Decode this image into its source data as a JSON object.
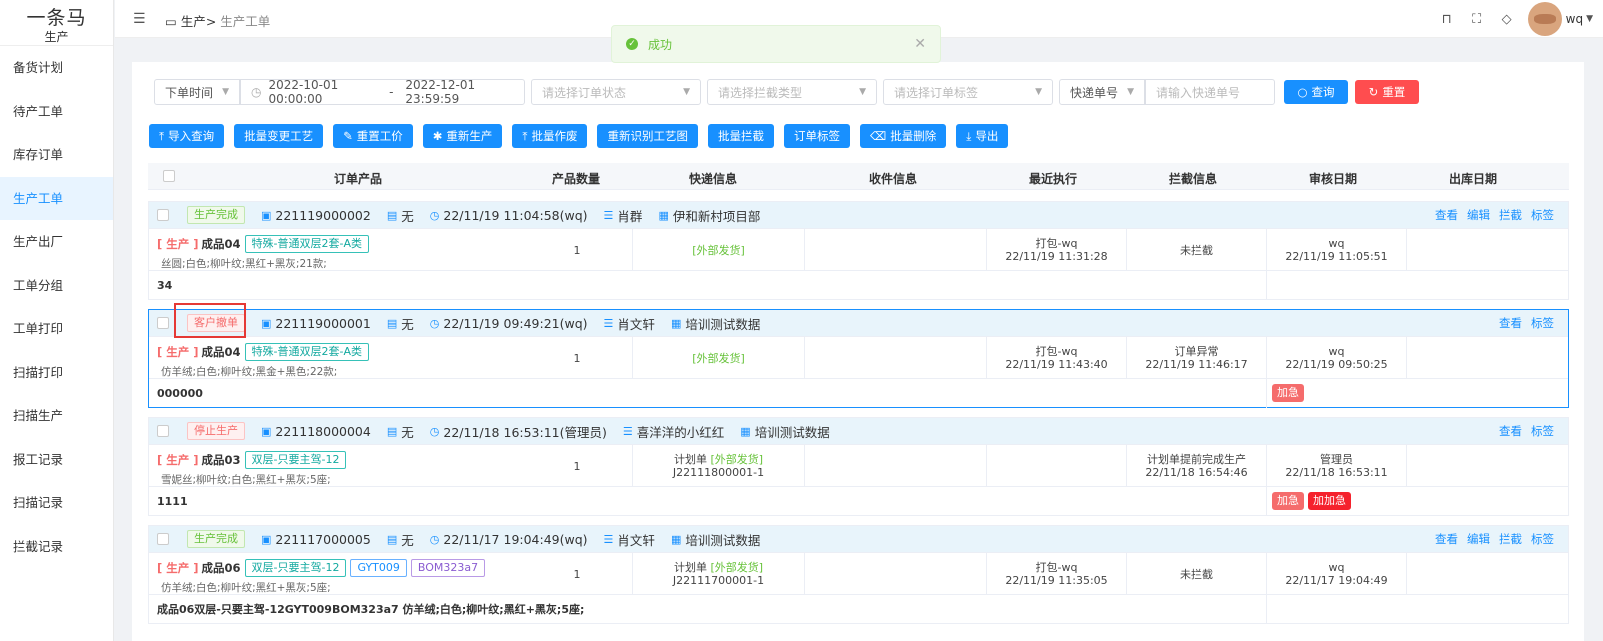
{
  "sidebar": {
    "brand": "一条马",
    "sub": "生产",
    "items": [
      {
        "label": "备货计划"
      },
      {
        "label": "待产工单"
      },
      {
        "label": "库存订单"
      },
      {
        "label": "生产工单",
        "active": true
      },
      {
        "label": "生产出厂"
      },
      {
        "label": "工单分组"
      },
      {
        "label": "工单打印"
      },
      {
        "label": "扫描打印"
      },
      {
        "label": "扫描生产"
      },
      {
        "label": "报工记录"
      },
      {
        "label": "扫描记录"
      },
      {
        "label": "拦截记录"
      }
    ]
  },
  "topbar": {
    "crumb_root": "生产",
    "crumb_sep": ">",
    "crumb_current": "生产工单",
    "user": "wq"
  },
  "toast": {
    "text": "成功"
  },
  "filters": {
    "time_type": "下单时间",
    "start": "2022-10-01 00:00:00",
    "dash": "-",
    "end": "2022-12-01 23:59:59",
    "status_ph": "请选择订单状态",
    "intercept_ph": "请选择拦截类型",
    "tag_ph": "请选择订单标签",
    "express_type": "快递单号",
    "express_ph": "请输入快递单号",
    "query": "查询",
    "reset": "重置"
  },
  "actions": [
    "导入查询",
    "批量变更工艺",
    "重置工价",
    "重新生产",
    "批量作废",
    "重新识别工艺图",
    "批量拦截",
    "订单标签",
    "批量删除",
    "导出"
  ],
  "columns": [
    "订单产品",
    "产品数量",
    "快递信息",
    "收件信息",
    "最近执行",
    "拦截信息",
    "审核日期",
    "出库日期"
  ],
  "orders": [
    {
      "status": "生产完成",
      "no": "221119000002",
      "flag": "无",
      "time": "22/11/19 11:04:58(wq)",
      "customer": "肖群",
      "project": "伊和新村项目部",
      "links": [
        "查看",
        "编辑",
        "拦截",
        "标签"
      ],
      "prod_state": "[ 生产 ]",
      "prod_name": "成品04",
      "tags": [
        "特殊-普通双层2套-A类"
      ],
      "spec": "丝圆;白色;柳叶纹;黑红+黑灰;21款;",
      "qty": "1",
      "express1": "[外部发货]",
      "express2": "",
      "recent1": "打包-wq",
      "recent2": "22/11/19 11:31:28",
      "intercept1": "未拦截",
      "intercept2": "",
      "audit1": "wq",
      "audit2": "22/11/19 11:05:51",
      "remark": "34",
      "urgent": []
    },
    {
      "status": "客户撤单",
      "no": "221119000001",
      "flag": "无",
      "time": "22/11/19 09:49:21(wq)",
      "customer": "肖文轩",
      "project": "培训测试数据",
      "links": [
        "查看",
        "标签"
      ],
      "prod_state": "[ 生产 ]",
      "prod_name": "成品04",
      "tags": [
        "特殊-普通双层2套-A类"
      ],
      "spec": "仿羊绒;白色;柳叶纹;黑金+黑色;22款;",
      "qty": "1",
      "express1": "[外部发货]",
      "express2": "",
      "recent1": "打包-wq",
      "recent2": "22/11/19 11:43:40",
      "intercept1": "订单异常",
      "intercept2": "22/11/19 11:46:17",
      "audit1": "wq",
      "audit2": "22/11/19 09:50:25",
      "remark": "000000",
      "urgent": [
        "加急"
      ]
    },
    {
      "status": "停止生产",
      "no": "221118000004",
      "flag": "无",
      "time": "22/11/18 16:53:11(管理员)",
      "customer": "喜洋洋的小红红",
      "project": "培训测试数据",
      "links": [
        "查看",
        "标签"
      ],
      "prod_state": "[ 生产 ]",
      "prod_name": "成品03",
      "tags": [
        "双层-只要主驾-12"
      ],
      "spec": "雪妮丝;柳叶纹;白色;黑红+黑灰;5座;",
      "qty": "1",
      "express_prefix": "计划单",
      "express1": "[外部发货]",
      "express2": "J22111800001-1",
      "recent1": "",
      "recent2": "",
      "intercept1": "计划单提前完成生产",
      "intercept2": "22/11/18 16:54:46",
      "audit1": "管理员",
      "audit2": "22/11/18 16:53:11",
      "remark": "1111",
      "urgent": [
        "加急",
        "加加急"
      ]
    },
    {
      "status": "生产完成",
      "no": "221117000005",
      "flag": "无",
      "time": "22/11/17 19:04:49(wq)",
      "customer": "肖文轩",
      "project": "培训测试数据",
      "links": [
        "查看",
        "编辑",
        "拦截",
        "标签"
      ],
      "prod_state": "[ 生产 ]",
      "prod_name": "成品06",
      "tags": [
        "双层-只要主驾-12",
        "GYT009",
        "BOM323a7"
      ],
      "spec": "仿羊绒;白色;柳叶纹;黑红+黑灰;5座;",
      "qty": "1",
      "express_prefix": "计划单",
      "express1": "[外部发货]",
      "express2": "J22111700001-1",
      "recent1": "打包-wq",
      "recent2": "22/11/19 11:35:05",
      "intercept1": "未拦截",
      "intercept2": "",
      "audit1": "wq",
      "audit2": "22/11/17 19:04:49",
      "remark": "成品06双层-只要主驾-12GYT009BOM323a7 仿羊绒;白色;柳叶纹;黑红+黑灰;5座;",
      "urgent": []
    }
  ]
}
